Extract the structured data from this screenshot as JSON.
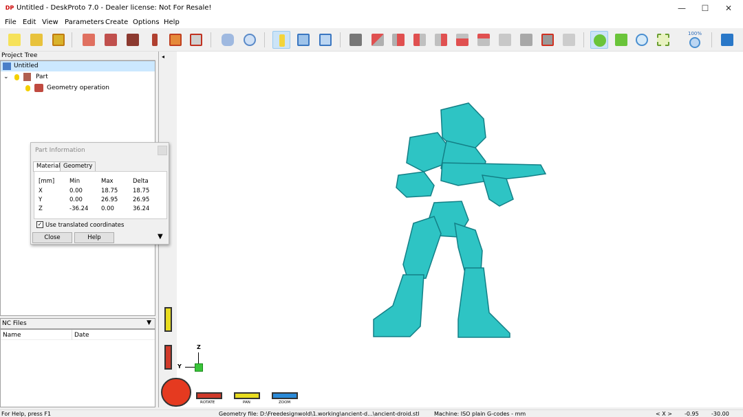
{
  "window": {
    "app_icon_text": "DP",
    "title": "Untitled - DeskProto 7.0 - Dealer license: Not For Resale!",
    "minimize": "—",
    "maximize": "☐",
    "close": "✕"
  },
  "menu": [
    "File",
    "Edit",
    "View",
    "Parameters",
    "Create",
    "Options",
    "Help"
  ],
  "toolbar": {
    "zoom_label": "100%"
  },
  "project_tree": {
    "header": "Project Tree",
    "root": "Untitled",
    "part": "Part",
    "operation": "Geometry operation",
    "expander": "⌄"
  },
  "nc_files": {
    "header": "NC Files",
    "col_name": "Name",
    "col_date": "Date",
    "dropdown": "▼"
  },
  "part_info": {
    "title": "Part Information",
    "tabs": [
      "Material",
      "Geometry"
    ],
    "headers": [
      "[mm]",
      "Min",
      "Max",
      "Delta"
    ],
    "rows": [
      [
        "X",
        "0.00",
        "18.75",
        "18.75"
      ],
      [
        "Y",
        "0.00",
        "26.95",
        "26.95"
      ],
      [
        "Z",
        "-36.24",
        "0.00",
        "36.24"
      ]
    ],
    "checkbox_label": "Use translated coordinates",
    "checkbox_checked": true,
    "close_label": "Close",
    "help_label": "Help",
    "more_arrow": "▼"
  },
  "viewport": {
    "collapse_arrow": "◂",
    "axis_z": "Z",
    "axis_y": "Y",
    "rotate_label": "ROTATE",
    "pan_label": "PAN",
    "zoom_label": "ZOOM",
    "model_color": "#2ec4c4"
  },
  "status": {
    "help": "For Help, press F1",
    "geometry_file": "Geometry file: D:\\Freedesignwold\\1.working\\ancient-d...\\ancient-droid.stl",
    "machine": "Machine: ISO plain G-codes - mm",
    "coord_label": "< X >",
    "coord_x": "-0.95",
    "coord_y": "-30.00"
  }
}
